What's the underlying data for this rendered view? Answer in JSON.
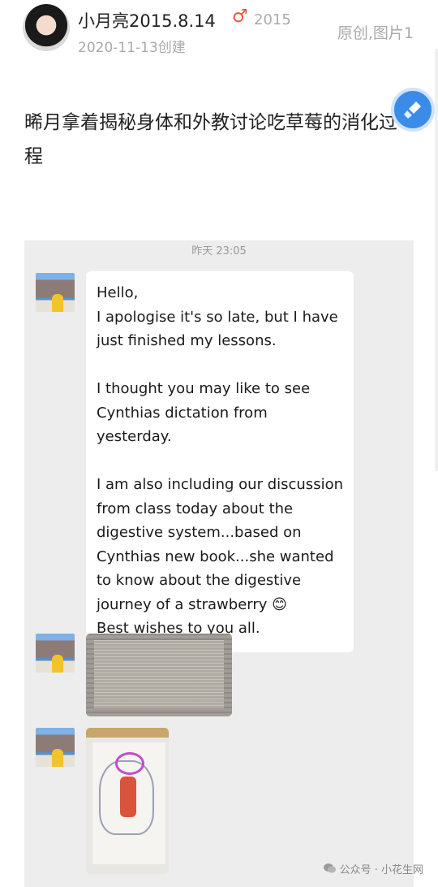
{
  "header": {
    "username": "小月亮2015.8.14",
    "gender_symbol": "♂",
    "year": "2015",
    "created": "2020-11-13创建",
    "meta_right": "原创,图片1"
  },
  "post": {
    "text": "晞月拿着揭秘身体和外教讨论吃草莓的消化过程"
  },
  "chat": {
    "timestamp": "昨天 23:05",
    "message": {
      "p1_line1": "Hello,",
      "p1_line2": "I apologise it's so late, but I have just finished my lessons.",
      "p2": "I thought you may like to see Cynthias dictation from yesterday.",
      "p3": "I am also including our discussion from class today about the digestive system...based on Cynthias new book...she wanted to know about the digestive journey of a strawberry 😊",
      "p4": "Best wishes to you all."
    }
  },
  "watermark": "公众号 · 小花生网",
  "icons": {
    "float_button": "broom-icon",
    "watermark": "wechat-icon"
  }
}
